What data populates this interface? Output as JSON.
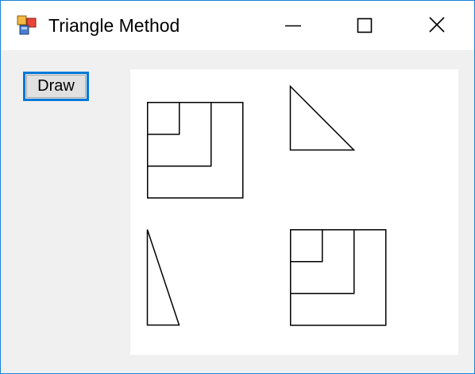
{
  "window": {
    "title": "Triangle Method",
    "icon": "winforms-app-icon",
    "controls": {
      "minimize_icon": "minimize-icon",
      "maximize_icon": "maximize-icon",
      "close_icon": "close-icon"
    },
    "border_color": "#1883d7"
  },
  "toolbar": {
    "draw_label": "Draw",
    "draw_focus_color": "#0078d7"
  },
  "canvas": {
    "background": "#ffffff",
    "stroke_color": "#000000",
    "shapes": [
      "nested-squares-top-left",
      "right-triangle-top-right",
      "tall-triangle-bottom-left",
      "nested-squares-bottom-right"
    ]
  }
}
